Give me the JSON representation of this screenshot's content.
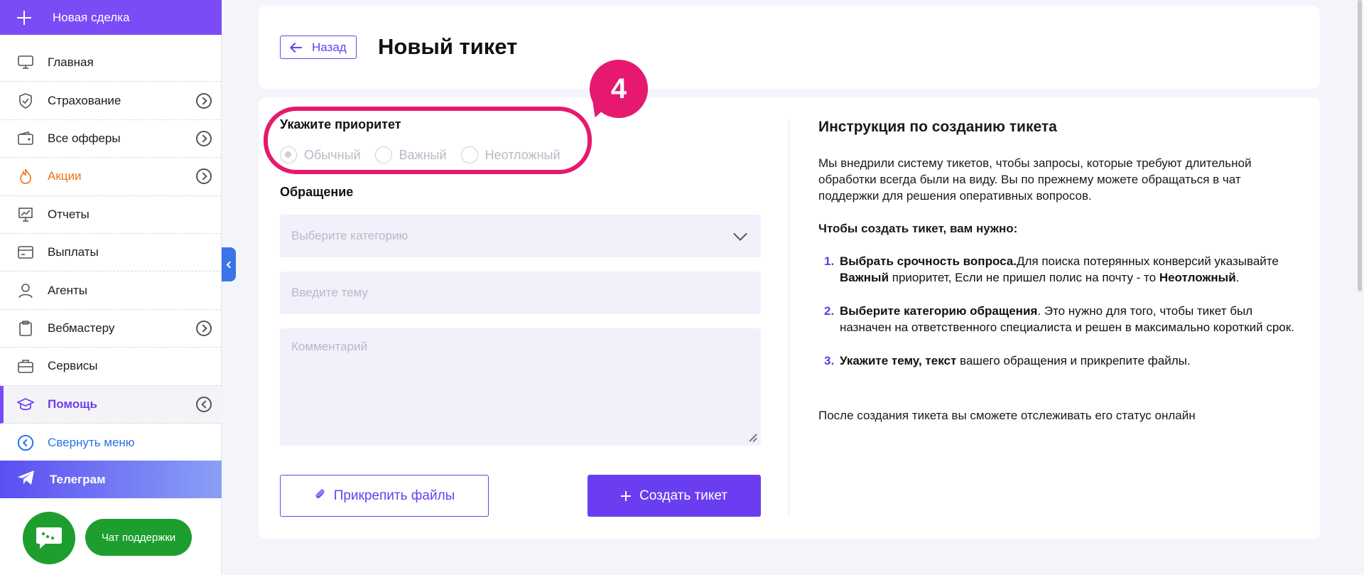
{
  "sidebar": {
    "new_deal": "Новая сделка",
    "items": [
      {
        "label": "Главная",
        "icon": "monitor-icon"
      },
      {
        "label": "Страхование",
        "icon": "shield-icon"
      },
      {
        "label": "Все офферы",
        "icon": "wallet-icon"
      },
      {
        "label": "Акции",
        "icon": "fire-icon"
      },
      {
        "label": "Отчеты",
        "icon": "presentation-icon"
      },
      {
        "label": "Выплаты",
        "icon": "card-icon"
      },
      {
        "label": "Агенты",
        "icon": "user-icon"
      },
      {
        "label": "Вебмастеру",
        "icon": "clipboard-icon"
      },
      {
        "label": "Сервисы",
        "icon": "briefcase-icon"
      },
      {
        "label": "Помощь",
        "icon": "graduation-cap-icon"
      },
      {
        "label": "Свернуть меню",
        "icon": "chevron-left-circle-icon"
      }
    ],
    "telegram": "Телеграм",
    "chat_support": "Чат поддержки"
  },
  "header": {
    "back_label": "Назад",
    "title": "Новый тикет"
  },
  "form": {
    "priority_label": "Укажите приоритет",
    "priorities": [
      "Обычный",
      "Важный",
      "Неотложный"
    ],
    "selected_priority": "Обычный",
    "appeal_label": "Обращение",
    "category_placeholder": "Выберите категорию",
    "topic_placeholder": "Введите тему",
    "comment_placeholder": "Комментарий",
    "attach_label": "Прикрепить файлы",
    "create_label": "Создать тикет"
  },
  "annotation": {
    "step_number": "4",
    "color": "#e6196e"
  },
  "instructions": {
    "title": "Инструкция по созданию тикета",
    "intro": "Мы внедрили систему тикетов, чтобы запросы, которые требуют длительной обработки всегда были на виду. Вы по прежнему можете обращаться в чат поддержки для решения оперативных вопросов.",
    "subtitle": "Чтобы создать тикет, вам нужно:",
    "steps": [
      {
        "num": "1.",
        "bold": "Выбрать срочность вопроса.",
        "text": "Для поиска потерянных конверсий указывайте ",
        "bold2": "Важный",
        "text2": " приоритет, Если не пришел полис на почту - то ",
        "bold3": "Неотложный",
        "text3": "."
      },
      {
        "num": "2.",
        "bold": "Выберите категорию обращения",
        "text": ". Это нужно для того, чтобы тикет был назначен на ответственного специалиста и решен в максимально короткий срок."
      },
      {
        "num": "3.",
        "bold": "Укажите тему, текст",
        "text": " вашего обращения и прикрепите файлы."
      }
    ],
    "footer": "После создания тикета вы сможете отслеживать его статус онлайн"
  },
  "colors": {
    "accent": "#6a3ef0",
    "sidebar_header": "#7a4cf6",
    "promo": "#f07018",
    "chat_green": "#1d9e2e",
    "collapse_blue": "#2a73e8"
  }
}
